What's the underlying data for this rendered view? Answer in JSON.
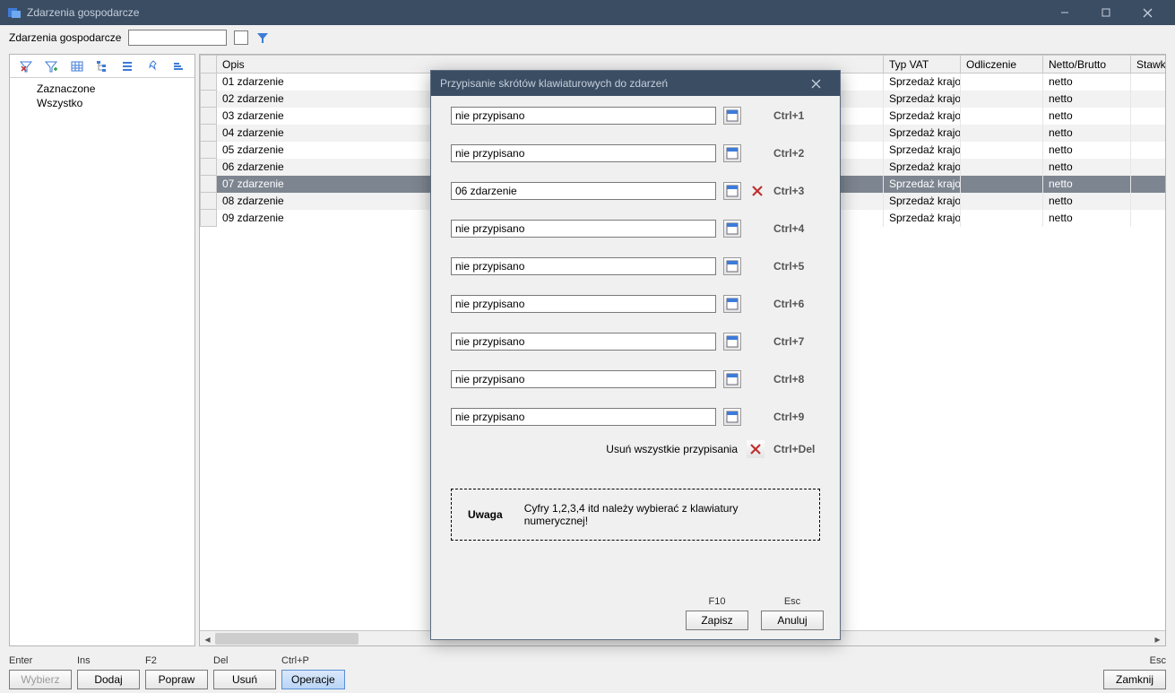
{
  "window": {
    "title": "Zdarzenia gospodarcze"
  },
  "filter": {
    "label": "Zdarzenia gospodarcze",
    "value": ""
  },
  "tree": {
    "items": [
      "Zaznaczone",
      "Wszystko"
    ]
  },
  "table": {
    "headers": {
      "opis": "Opis",
      "typVat": "Typ VAT",
      "odliczenie": "Odliczenie",
      "nettoBrutto": "Netto/Brutto",
      "stawka": "Stawka"
    },
    "rowhead": "",
    "rows": [
      {
        "opis": "01 zdarzenie",
        "typVat": "Sprzedaż krajow",
        "odliczenie": "",
        "nettoBrutto": "netto",
        "sel": false
      },
      {
        "opis": "02 zdarzenie",
        "typVat": "Sprzedaż krajow",
        "odliczenie": "",
        "nettoBrutto": "netto",
        "sel": false
      },
      {
        "opis": "03 zdarzenie",
        "typVat": "Sprzedaż krajow",
        "odliczenie": "",
        "nettoBrutto": "netto",
        "sel": false
      },
      {
        "opis": "04 zdarzenie",
        "typVat": "Sprzedaż krajow",
        "odliczenie": "",
        "nettoBrutto": "netto",
        "sel": false
      },
      {
        "opis": "05 zdarzenie",
        "typVat": "Sprzedaż krajow",
        "odliczenie": "",
        "nettoBrutto": "netto",
        "sel": false
      },
      {
        "opis": "06 zdarzenie",
        "typVat": "Sprzedaż krajow",
        "odliczenie": "",
        "nettoBrutto": "netto",
        "sel": false
      },
      {
        "opis": "07 zdarzenie",
        "typVat": "Sprzedaż krajow",
        "odliczenie": "",
        "nettoBrutto": "netto",
        "sel": true
      },
      {
        "opis": "08 zdarzenie",
        "typVat": "Sprzedaż krajow",
        "odliczenie": "",
        "nettoBrutto": "netto",
        "sel": false
      },
      {
        "opis": "09 zdarzenie",
        "typVat": "Sprzedaż krajow",
        "odliczenie": "",
        "nettoBrutto": "netto",
        "sel": false
      }
    ]
  },
  "buttons": {
    "wybierz": {
      "hint": "Enter",
      "label": "Wybierz"
    },
    "dodaj": {
      "hint": "Ins",
      "label": "Dodaj"
    },
    "popraw": {
      "hint": "F2",
      "label": "Popraw"
    },
    "usun": {
      "hint": "Del",
      "label": "Usuń"
    },
    "operacje": {
      "hint": "Ctrl+P",
      "label": "Operacje"
    },
    "zamknij": {
      "hint": "Esc",
      "label": "Zamknij"
    }
  },
  "dialog": {
    "title": "Przypisanie skrótów klawiaturowych do zdarzeń",
    "unassigned": "nie przypisano",
    "rows": [
      {
        "value": "nie przypisano",
        "shortcut": "Ctrl+1",
        "clearable": false
      },
      {
        "value": "nie przypisano",
        "shortcut": "Ctrl+2",
        "clearable": false
      },
      {
        "value": "06 zdarzenie",
        "shortcut": "Ctrl+3",
        "clearable": true
      },
      {
        "value": "nie przypisano",
        "shortcut": "Ctrl+4",
        "clearable": false
      },
      {
        "value": "nie przypisano",
        "shortcut": "Ctrl+5",
        "clearable": false
      },
      {
        "value": "nie przypisano",
        "shortcut": "Ctrl+6",
        "clearable": false
      },
      {
        "value": "nie przypisano",
        "shortcut": "Ctrl+7",
        "clearable": false
      },
      {
        "value": "nie przypisano",
        "shortcut": "Ctrl+8",
        "clearable": false
      },
      {
        "value": "nie przypisano",
        "shortcut": "Ctrl+9",
        "clearable": false
      }
    ],
    "deleteAll": {
      "label": "Usuń wszystkie przypisania",
      "shortcut": "Ctrl+Del"
    },
    "note": {
      "heading": "Uwaga",
      "text": "Cyfry 1,2,3,4 itd należy wybierać z klawiatury numerycznej!"
    },
    "save": {
      "hint": "F10",
      "label": "Zapisz"
    },
    "cancel": {
      "hint": "Esc",
      "label": "Anuluj"
    }
  }
}
